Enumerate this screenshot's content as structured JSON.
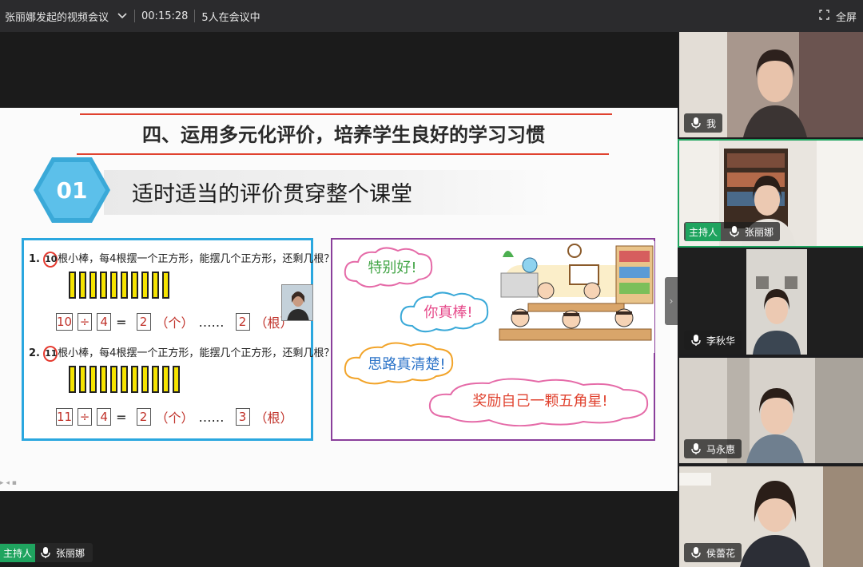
{
  "topbar": {
    "meeting_title": "张丽娜发起的视频会议",
    "elapsed": "00:15:28",
    "participants": "5人在会议中",
    "fullscreen_label": "全屏"
  },
  "slide": {
    "title": "四、运用多元化评价，培养学生良好的学习习惯",
    "section_num": "01",
    "subtitle": "适时适当的评价贯穿整个课堂",
    "q1": {
      "index": "1.",
      "circled": "10",
      "text": "根小棒，每4根摆一个正方形，能摆几个正方形，还剩几根？",
      "eq_a": "10",
      "op": "÷",
      "eq_b": "4",
      "eqsign": "=",
      "q": "2",
      "unit1": "（个）",
      "dots": "……",
      "r": "2",
      "unit2": "（根）"
    },
    "q2": {
      "index": "2.",
      "circled": "11",
      "text": "根小棒，每4根摆一个正方形，能摆几个正方形，还剩几根？",
      "eq_a": "11",
      "op": "÷",
      "eq_b": "4",
      "eqsign": "=",
      "q": "2",
      "unit1": "（个）",
      "dots": "……",
      "r": "3",
      "unit2": "（根）"
    },
    "praise": [
      "特别好!",
      "你真棒!",
      "思路真清楚!",
      "奖励自己一颗五角星!"
    ],
    "colors": {
      "accent_red": "#e0422f",
      "hex_blue": "#3aa9d8",
      "box_blue": "#2aa7df",
      "box_purple": "#8a3f9b"
    }
  },
  "presenter": {
    "badge": "主持人",
    "name": "张丽娜"
  },
  "participants": [
    {
      "name": "我",
      "host": false
    },
    {
      "name": "张丽娜",
      "host": true,
      "badge": "主持人"
    },
    {
      "name": "李秋华",
      "host": false
    },
    {
      "name": "马永惠",
      "host": false
    },
    {
      "name": "侯蕾花",
      "host": false
    }
  ]
}
